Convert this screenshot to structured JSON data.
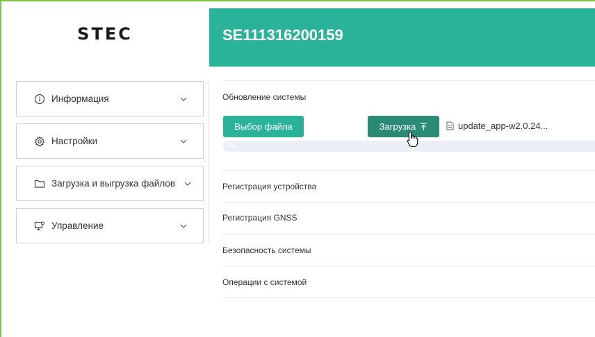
{
  "sidebar": {
    "logo": "STEC",
    "items": [
      {
        "label": "Информация",
        "icon": "info-icon"
      },
      {
        "label": "Настройки",
        "icon": "gear-icon"
      },
      {
        "label": "Загрузка и выгрузка файлов",
        "icon": "folder-icon"
      },
      {
        "label": "Управление",
        "icon": "monitor-settings-icon"
      }
    ]
  },
  "header": {
    "device_id": "SE111316200159"
  },
  "update": {
    "title": "Обновление системы",
    "select_file_label": "Выбор файла",
    "upload_label": "Загрузка",
    "file_name": "update_app-w2.0.24...",
    "progress_text": "0%",
    "progress_value": 0
  },
  "sections": [
    {
      "label": "Регистрация устройства"
    },
    {
      "label": "Регистрация GNSS"
    },
    {
      "label": "Безопасность системы"
    },
    {
      "label": "Операции с системой"
    }
  ],
  "colors": {
    "accent": "#2bb39a",
    "accent_dark": "#2a8a76",
    "frame": "#7cc443"
  }
}
